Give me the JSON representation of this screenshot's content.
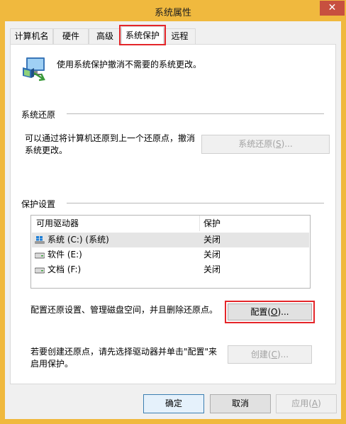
{
  "window": {
    "title": "系统属性",
    "close_glyph": "✕"
  },
  "tabs": [
    {
      "label": "计算机名"
    },
    {
      "label": "硬件"
    },
    {
      "label": "高级"
    },
    {
      "label": "系统保护",
      "selected": true
    },
    {
      "label": "远程"
    }
  ],
  "intro": {
    "text": "使用系统保护撤消不需要的系统更改。",
    "icon": "system-protection-icon"
  },
  "restore": {
    "group_title": "系统还原",
    "description_line1": "可以通过将计算机还原到上一个还原点，撤消",
    "description_line2": "系统更改。",
    "button_prefix": "系统还原(",
    "button_key": "S",
    "button_suffix": ")...",
    "button_enabled": false
  },
  "protection": {
    "group_title": "保护设置",
    "columns": [
      "可用驱动器",
      "保护"
    ],
    "drives": [
      {
        "name": "系统 (C:) (系统)",
        "protection": "关闭",
        "icon": "windows-drive-icon",
        "selected": true
      },
      {
        "name": "软件 (E:)",
        "protection": "关闭",
        "icon": "hard-drive-icon"
      },
      {
        "name": "文档 (F:)",
        "protection": "关闭",
        "icon": "hard-drive-icon"
      }
    ],
    "configure_text": "配置还原设置、管理磁盘空间，并且删除还原点。",
    "configure_prefix": "配置(",
    "configure_key": "O",
    "configure_suffix": ")...",
    "create_line1": "若要创建还原点，请先选择驱动器并单击\"配置\"来",
    "create_line2": "启用保护。",
    "create_prefix": "创建(",
    "create_key": "C",
    "create_suffix": ")...",
    "create_enabled": false
  },
  "footer": {
    "ok": "确定",
    "cancel": "取消",
    "apply_prefix": "应用(",
    "apply_key": "A",
    "apply_suffix": ")",
    "apply_enabled": false
  },
  "colors": {
    "title_bar": "#f0b93e",
    "close_button": "#c7503f",
    "highlight": "#e4262a",
    "focus_border": "#3c7fb1"
  }
}
